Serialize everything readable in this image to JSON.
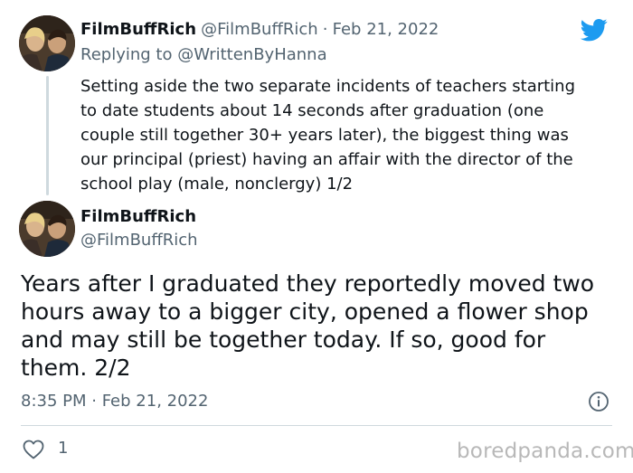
{
  "reply_tweet": {
    "author_name": "FilmBuffRich",
    "author_handle": "@FilmBuffRich",
    "separator": "·",
    "date": "Feb 21, 2022",
    "replying_label": "Replying to",
    "replying_handle": "@WrittenByHanna",
    "text_lines": [
      "Setting aside the two separate incidents of teachers starting",
      "to date students about 14 seconds after graduation (one",
      "couple still together 30+ years later), the biggest thing was",
      "our principal (priest) having an affair with the director of the",
      "school play (male, nonclergy) 1/2"
    ]
  },
  "main_tweet": {
    "author_name": "FilmBuffRich",
    "author_handle": "@FilmBuffRich",
    "text_lines": [
      "Years after I graduated they reportedly moved two",
      "hours away to a bigger city, opened a flower shop",
      "and may still be together today. If so, good for",
      "them. 2/2"
    ],
    "timestamp": "8:35 PM · Feb 21, 2022",
    "like_count": "1"
  },
  "icons": {
    "brand": "twitter-bird-icon",
    "info": "info-icon",
    "like": "heart-icon"
  },
  "colors": {
    "twitter_blue": "#1d9bf0",
    "secondary_text": "#536471",
    "divider": "#cfd9de"
  },
  "watermark": "boredpanda.com"
}
